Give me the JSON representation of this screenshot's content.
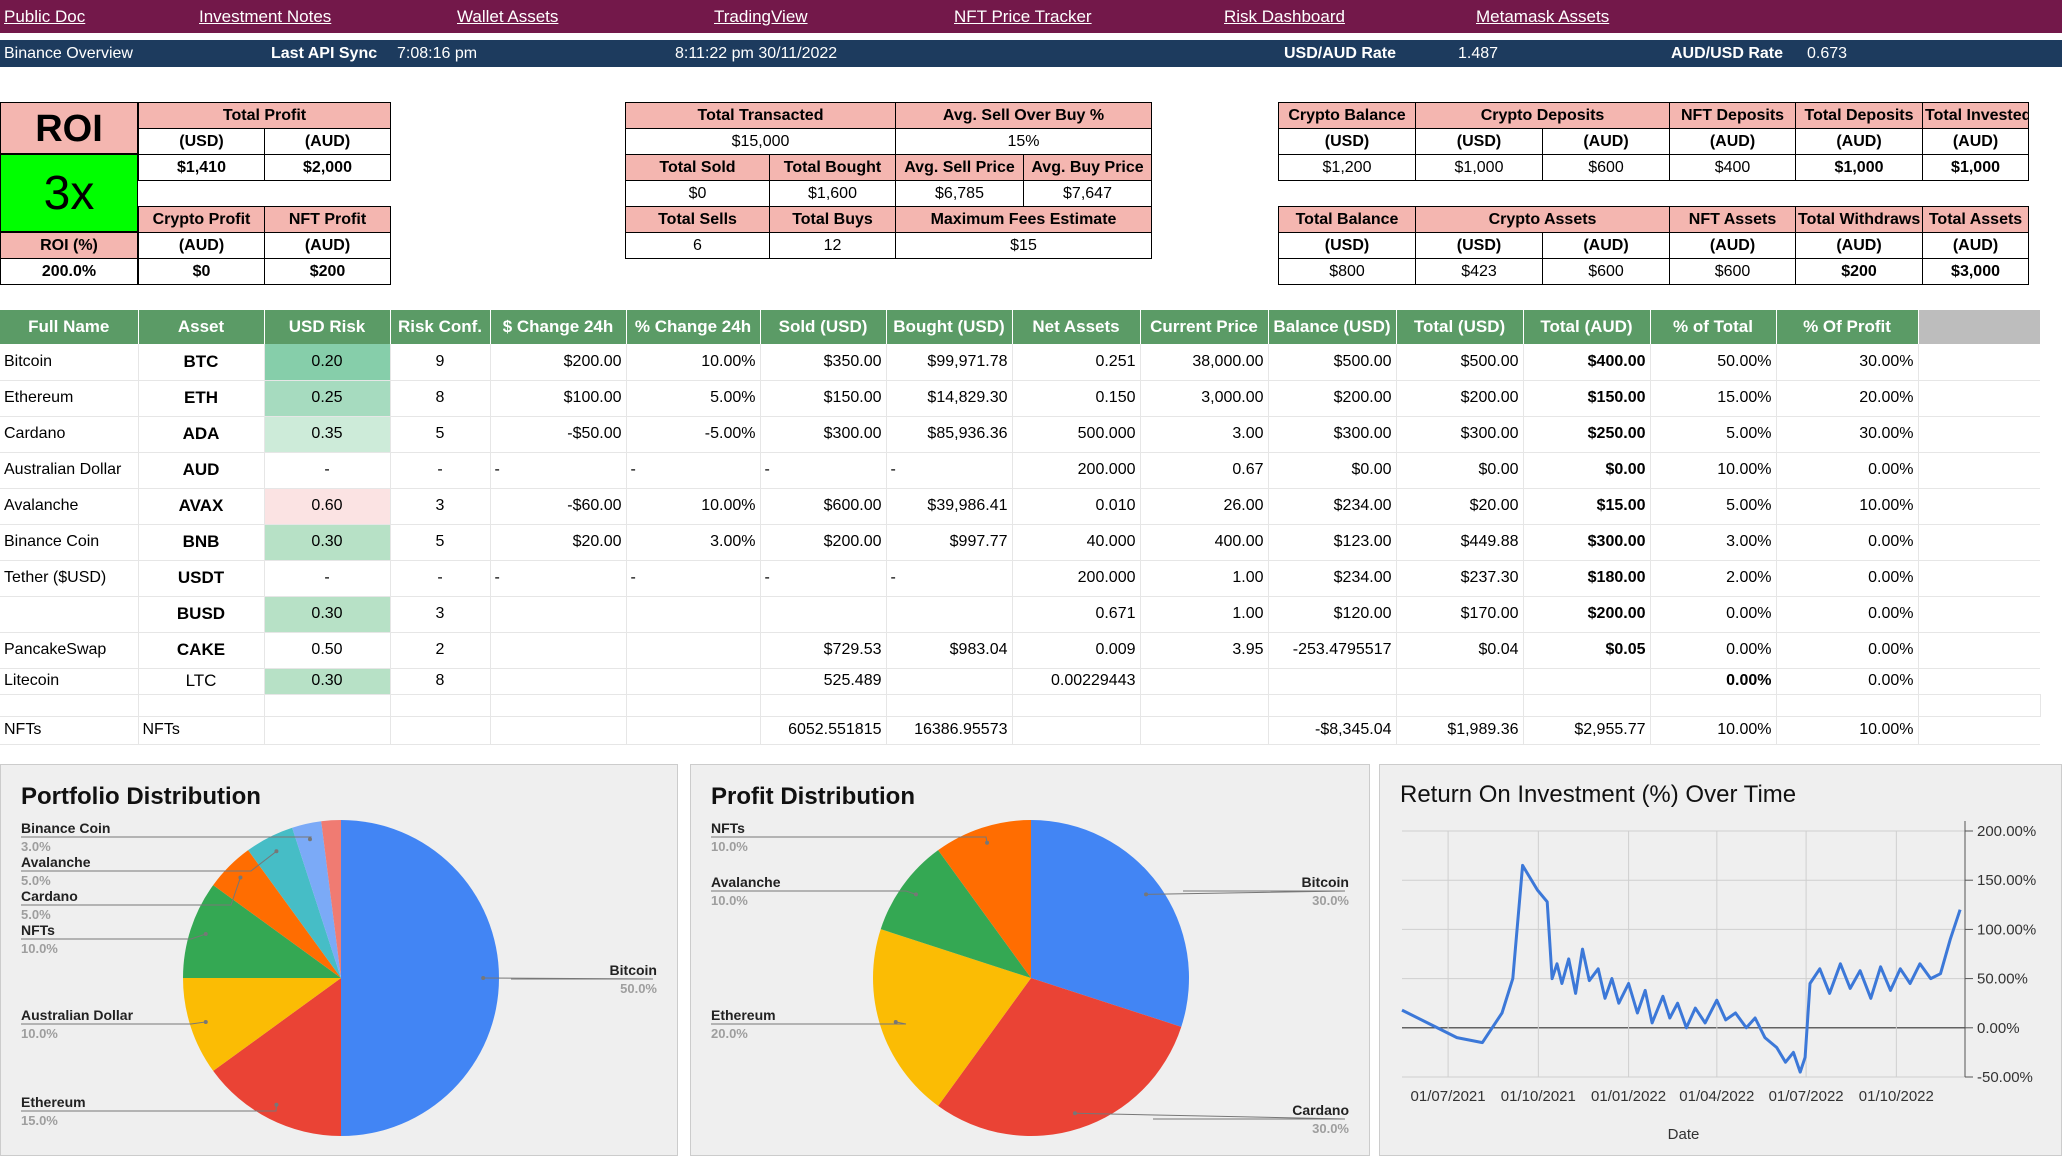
{
  "nav": [
    "Public Doc",
    "Investment Notes",
    "Wallet Assets",
    "TradingView",
    "NFT Price Tracker",
    "Risk Dashboard",
    "Metamask Assets"
  ],
  "api_bar": {
    "title": "Binance Overview",
    "last_sync_label": "Last API Sync",
    "last_sync_time": "7:08:16 pm",
    "datetime": "8:11:22 pm 30/11/2022",
    "usd_aud_label": "USD/AUD Rate",
    "usd_aud_value": "1.487",
    "aud_usd_label": "AUD/USD Rate",
    "aud_usd_value": "0.673"
  },
  "roi": {
    "label": "ROI",
    "multiplier": "3x",
    "pct_label": "ROI (%)",
    "pct_value": "200.0%",
    "total_profit_label": "Total Profit",
    "usd_label": "(USD)",
    "aud_label": "(AUD)",
    "total_profit_usd": "$1,410",
    "total_profit_aud": "$2,000",
    "crypto_profit_label": "Crypto Profit",
    "nft_profit_label": "NFT Profit",
    "crypto_profit_aud": "$0",
    "nft_profit_aud": "$200"
  },
  "transactions": {
    "total_transacted_label": "Total Transacted",
    "total_transacted": "$15,000",
    "avg_sell_over_buy_label": "Avg. Sell Over Buy %",
    "avg_sell_over_buy": "15%",
    "total_sold_label": "Total Sold",
    "total_bought_label": "Total Bought",
    "avg_sell_price_label": "Avg. Sell Price",
    "avg_buy_price_label": "Avg. Buy Price",
    "total_sold": "$0",
    "total_bought": "$1,600",
    "avg_sell_price": "$6,785",
    "avg_buy_price": "$7,647",
    "total_sells_label": "Total Sells",
    "total_buys_label": "Total Buys",
    "max_fees_label": "Maximum Fees Estimate",
    "total_sells": "6",
    "total_buys": "12",
    "max_fees": "$15"
  },
  "balances_top": {
    "headers": [
      "Crypto Balance",
      "Crypto Deposits",
      "NFT Deposits",
      "Total Deposits",
      "Total Invested"
    ],
    "units": [
      "(USD)",
      "(USD)",
      "(AUD)",
      "(AUD)",
      "(AUD)",
      "(AUD)"
    ],
    "values": [
      "$1,200",
      "$1,000",
      "$600",
      "$400",
      "$1,000",
      "$1,000"
    ]
  },
  "balances_bottom": {
    "headers": [
      "Total Balance",
      "Crypto Assets",
      "NFT Assets",
      "Total Withdraws",
      "Total Assets"
    ],
    "units": [
      "(USD)",
      "(USD)",
      "(AUD)",
      "(AUD)",
      "(AUD)",
      "(AUD)"
    ],
    "values": [
      "$800",
      "$423",
      "$600",
      "$600",
      "$200",
      "$3,000"
    ]
  },
  "table": {
    "headers": [
      "Full Name",
      "Asset",
      "USD Risk",
      "Risk Conf.",
      "$ Change 24h",
      "% Change 24h",
      "Sold (USD)",
      "Bought (USD)",
      "Net Assets",
      "Current Price",
      "Balance (USD)",
      "Total (USD)",
      "Total (AUD)",
      "% of Total",
      "% Of Profit"
    ],
    "rows": [
      [
        "Bitcoin",
        "BTC",
        "0.20",
        "9",
        "$200.00",
        "10.00%",
        "$350.00",
        "$99,971.78",
        "0.251",
        "38,000.00",
        "$500.00",
        "$500.00",
        "$400.00",
        "50.00%",
        "30.00%"
      ],
      [
        "Ethereum",
        "ETH",
        "0.25",
        "8",
        "$100.00",
        "5.00%",
        "$150.00",
        "$14,829.30",
        "0.150",
        "3,000.00",
        "$200.00",
        "$200.00",
        "$150.00",
        "15.00%",
        "20.00%"
      ],
      [
        "Cardano",
        "ADA",
        "0.35",
        "5",
        "-$50.00",
        "-5.00%",
        "$300.00",
        "$85,936.36",
        "500.000",
        "3.00",
        "$300.00",
        "$300.00",
        "$250.00",
        "5.00%",
        "30.00%"
      ],
      [
        "Australian Dollar",
        "AUD",
        "-",
        "-",
        "-",
        "-",
        "-",
        "-",
        "200.000",
        "0.67",
        "$0.00",
        "$0.00",
        "$0.00",
        "10.00%",
        "0.00%"
      ],
      [
        "Avalanche",
        "AVAX",
        "0.60",
        "3",
        "-$60.00",
        "10.00%",
        "$600.00",
        "$39,986.41",
        "0.010",
        "26.00",
        "$234.00",
        "$20.00",
        "$15.00",
        "5.00%",
        "10.00%"
      ],
      [
        "Binance Coin",
        "BNB",
        "0.30",
        "5",
        "$20.00",
        "3.00%",
        "$200.00",
        "$997.77",
        "40.000",
        "400.00",
        "$123.00",
        "$449.88",
        "$300.00",
        "3.00%",
        "0.00%"
      ],
      [
        "Tether ($USD)",
        "USDT",
        "-",
        "-",
        "-",
        "-",
        "-",
        "-",
        "200.000",
        "1.00",
        "$234.00",
        "$237.30",
        "$180.00",
        "2.00%",
        "0.00%"
      ],
      [
        "",
        "BUSD",
        "0.30",
        "3",
        "",
        "",
        "",
        "",
        "0.671",
        "1.00",
        "$120.00",
        "$170.00",
        "$200.00",
        "0.00%",
        "0.00%"
      ],
      [
        "PancakeSwap",
        "CAKE",
        "0.50",
        "2",
        "",
        "",
        "$729.53",
        "$983.04",
        "0.009",
        "3.95",
        "-253.4795517",
        "$0.04",
        "$0.05",
        "0.00%",
        "0.00%"
      ],
      [
        "Litecoin",
        "LTC",
        "0.30",
        "8",
        "",
        "",
        "525.489",
        "",
        "0.00229443",
        "",
        "",
        "",
        "",
        "0.00%",
        "0.00%"
      ]
    ],
    "nft_row": [
      "NFTs",
      "NFTs",
      "",
      "",
      "",
      "",
      "6052.551815",
      "16386.95573",
      "",
      "",
      "-$8,345.04",
      "$1,989.36",
      "$2,955.77",
      "10.00%",
      "10.00%"
    ]
  },
  "colors": {
    "nav_bg": "#73184a",
    "api_bg": "#1d3b5e",
    "header_pink": "#f4b6b0",
    "table_header": "#5b9b66",
    "roi_green": "#00ff00"
  },
  "chart_data": [
    {
      "type": "pie",
      "title": "Portfolio Distribution",
      "series": [
        {
          "name": "Bitcoin",
          "label": "50.0%",
          "value": 50,
          "color": "#4285f4"
        },
        {
          "name": "Ethereum",
          "label": "15.0%",
          "value": 15,
          "color": "#ea4335"
        },
        {
          "name": "Australian Dollar",
          "label": "10.0%",
          "value": 10,
          "color": "#fbbc04"
        },
        {
          "name": "NFTs",
          "label": "10.0%",
          "value": 10,
          "color": "#34a853"
        },
        {
          "name": "Cardano",
          "label": "5.0%",
          "value": 5,
          "color": "#ff6d01"
        },
        {
          "name": "Avalanche",
          "label": "5.0%",
          "value": 5,
          "color": "#46bdc6"
        },
        {
          "name": "Binance Coin",
          "label": "3.0%",
          "value": 3,
          "color": "#7baaf7"
        },
        {
          "name": "",
          "label": "",
          "value": 2,
          "color": "#f07b72"
        }
      ]
    },
    {
      "type": "pie",
      "title": "Profit Distribution",
      "series": [
        {
          "name": "Bitcoin",
          "label": "30.0%",
          "value": 30,
          "color": "#4285f4"
        },
        {
          "name": "Cardano",
          "label": "30.0%",
          "value": 30,
          "color": "#ea4335"
        },
        {
          "name": "Ethereum",
          "label": "20.0%",
          "value": 20,
          "color": "#fbbc04"
        },
        {
          "name": "Avalanche",
          "label": "10.0%",
          "value": 10,
          "color": "#34a853"
        },
        {
          "name": "NFTs",
          "label": "10.0%",
          "value": 10,
          "color": "#ff6d01"
        }
      ]
    },
    {
      "type": "line",
      "title": "Return On Investment (%) Over Time",
      "xlabel": "Date",
      "x_ticks": [
        "01/07/2021",
        "01/10/2021",
        "01/01/2022",
        "01/04/2022",
        "01/07/2022",
        "01/10/2022"
      ],
      "y_ticks": [
        "200.00%",
        "150.00%",
        "100.00%",
        "50.00%",
        "0.00%",
        "-50.00%"
      ],
      "ylim": [
        -50,
        200
      ],
      "xlim": [
        "2021-05-15",
        "2022-12-10"
      ],
      "color": "#3c78d8",
      "points": [
        [
          "2021-05-15",
          18
        ],
        [
          "2021-06-10",
          5
        ],
        [
          "2021-07-10",
          -10
        ],
        [
          "2021-08-05",
          -15
        ],
        [
          "2021-08-25",
          15
        ],
        [
          "2021-09-05",
          50
        ],
        [
          "2021-09-15",
          165
        ],
        [
          "2021-09-30",
          140
        ],
        [
          "2021-10-10",
          128
        ],
        [
          "2021-10-15",
          50
        ],
        [
          "2021-10-20",
          65
        ],
        [
          "2021-10-25",
          45
        ],
        [
          "2021-11-01",
          70
        ],
        [
          "2021-11-08",
          35
        ],
        [
          "2021-11-15",
          80
        ],
        [
          "2021-11-22",
          48
        ],
        [
          "2021-12-01",
          60
        ],
        [
          "2021-12-08",
          30
        ],
        [
          "2021-12-15",
          50
        ],
        [
          "2021-12-22",
          25
        ],
        [
          "2022-01-01",
          45
        ],
        [
          "2022-01-10",
          15
        ],
        [
          "2022-01-18",
          38
        ],
        [
          "2022-01-25",
          5
        ],
        [
          "2022-02-05",
          32
        ],
        [
          "2022-02-12",
          10
        ],
        [
          "2022-02-20",
          25
        ],
        [
          "2022-03-01",
          0
        ],
        [
          "2022-03-10",
          20
        ],
        [
          "2022-03-20",
          5
        ],
        [
          "2022-04-01",
          28
        ],
        [
          "2022-04-10",
          8
        ],
        [
          "2022-04-20",
          15
        ],
        [
          "2022-05-01",
          0
        ],
        [
          "2022-05-10",
          10
        ],
        [
          "2022-05-20",
          -10
        ],
        [
          "2022-06-01",
          -20
        ],
        [
          "2022-06-10",
          -35
        ],
        [
          "2022-06-18",
          -25
        ],
        [
          "2022-06-25",
          -45
        ],
        [
          "2022-06-30",
          -30
        ],
        [
          "2022-07-05",
          45
        ],
        [
          "2022-07-15",
          60
        ],
        [
          "2022-07-25",
          35
        ],
        [
          "2022-08-05",
          65
        ],
        [
          "2022-08-15",
          40
        ],
        [
          "2022-08-25",
          58
        ],
        [
          "2022-09-05",
          30
        ],
        [
          "2022-09-15",
          62
        ],
        [
          "2022-09-25",
          38
        ],
        [
          "2022-10-05",
          60
        ],
        [
          "2022-10-15",
          45
        ],
        [
          "2022-10-25",
          65
        ],
        [
          "2022-11-05",
          50
        ],
        [
          "2022-11-15",
          55
        ],
        [
          "2022-11-25",
          90
        ],
        [
          "2022-12-05",
          120
        ]
      ]
    }
  ]
}
